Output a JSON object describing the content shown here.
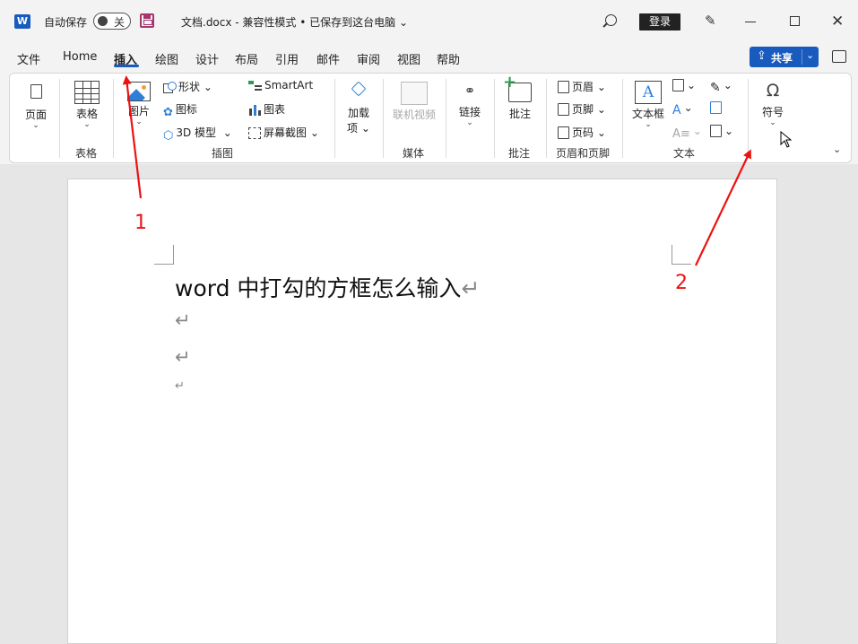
{
  "titlebar": {
    "autosave_label": "自动保存",
    "autosave_state": "关",
    "doc_title": "文档.docx  -  兼容性模式 • 已保存到这台电脑 ⌄",
    "login": "登录",
    "logo_letter": "W"
  },
  "tabs": [
    "文件",
    "Home",
    "插入",
    "绘图",
    "设计",
    "布局",
    "引用",
    "邮件",
    "审阅",
    "视图",
    "帮助"
  ],
  "active_tab": "插入",
  "share": {
    "label": "共享",
    "chevron": "⌄"
  },
  "ribbon": {
    "page": {
      "label": "页面"
    },
    "table": {
      "label": "表格",
      "group": "表格"
    },
    "picture": {
      "label": "图片"
    },
    "shapes": "形状",
    "icons": "图标",
    "model3d": "3D 模型",
    "smartart": "SmartArt",
    "chart": "图表",
    "screenshot": "屏幕截图",
    "illus_group": "插图",
    "addins": {
      "label1": "加载",
      "label2": "项"
    },
    "online_video": "联机视频",
    "media_group": "媒体",
    "link": "链接",
    "comment": "批注",
    "comment_group": "批注",
    "header": "页眉",
    "footer": "页脚",
    "page_number": "页码",
    "hf_group": "页眉和页脚",
    "textbox": "文本框",
    "textbox_letter": "A",
    "text_group": "文本",
    "symbol": "符号",
    "symbol_glyph": "Ω"
  },
  "document": {
    "line1": "word 中打勾的方框怎么输入",
    "pilcrow": "↵"
  },
  "annotations": {
    "n1": "1",
    "n2": "2"
  }
}
